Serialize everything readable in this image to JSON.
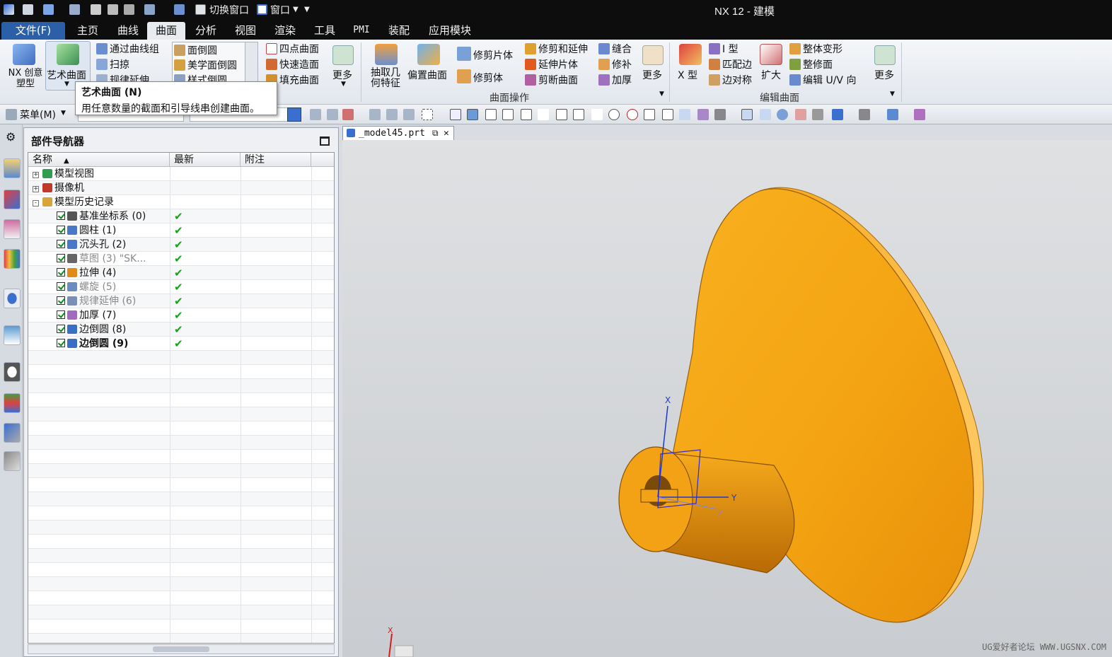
{
  "titlebar": {
    "switch_window": "切换窗口",
    "window": "窗口",
    "title": "NX 12 - 建模"
  },
  "tabs": [
    "文件(F)",
    "主页",
    "曲线",
    "曲面",
    "分析",
    "视图",
    "渲染",
    "工具",
    "PMI",
    "装配",
    "应用模块"
  ],
  "ribbon": {
    "nx_creative": "NX 创意塑型",
    "art_surface": "艺术曲面",
    "through_curve_mesh": "通过曲线组",
    "sweep": "扫掠",
    "law_extension": "规律延伸",
    "face_blend": "面倒圆",
    "aesthetic_blend": "美学面倒圆",
    "style_blend": "样式倒圆",
    "four_point": "四点曲面",
    "rapid_surface": "快速造面",
    "fill_surface": "填充曲面",
    "more1": "更多",
    "extract_geometry": "抽取几何特征",
    "offset_surface": "偏置曲面",
    "trim_sheet": "修剪片体",
    "trim_body": "修剪体",
    "trim_extend": "修剪和延伸",
    "extend_sheet": "延伸片体",
    "divide_face": "剪断曲面",
    "sew": "缝合",
    "patch": "修补",
    "thicken": "加厚",
    "more2": "更多",
    "group_surface_ops": "曲面操作",
    "x_form": "X 型",
    "i_form": "I 型",
    "match_edge": "匹配边",
    "symmetric": "边对称",
    "enlarge": "扩大",
    "global_shaping": "整体变形",
    "global_face": "整修面",
    "edit_uv": "编辑 U/V 向",
    "more3": "更多",
    "group_edit_surface": "编辑曲面"
  },
  "tooltip": {
    "title": "艺术曲面 (N)",
    "text": "用任意数量的截面和引导线串创建曲面。"
  },
  "toolbar2": {
    "menu": "菜单(M)"
  },
  "navigator": {
    "title": "部件导航器",
    "columns": [
      "名称",
      "最新",
      "附注"
    ],
    "rows": [
      {
        "name": "模型视图",
        "latest": "",
        "level": 0,
        "expander": "+",
        "icon_color": "#2f9e52"
      },
      {
        "name": "摄像机",
        "latest": "",
        "level": 0,
        "expander": "+",
        "icon_color": "#c0392b"
      },
      {
        "name": "模型历史记录",
        "latest": "",
        "level": 0,
        "expander": "-",
        "icon_color": "#d9a53a"
      },
      {
        "name": "基准坐标系 (0)",
        "latest": "✔",
        "level": 1,
        "icon_color": "#555555",
        "dim": false
      },
      {
        "name": "圆柱 (1)",
        "latest": "✔",
        "level": 1,
        "icon_color": "#4a78c8",
        "dim": false
      },
      {
        "name": "沉头孔 (2)",
        "latest": "✔",
        "level": 1,
        "icon_color": "#4a78c8",
        "dim": false
      },
      {
        "name": "草图 (3) \"SK...",
        "latest": "✔",
        "level": 1,
        "icon_color": "#666666",
        "dim": true
      },
      {
        "name": "拉伸 (4)",
        "latest": "✔",
        "level": 1,
        "icon_color": "#e08a1a",
        "dim": false
      },
      {
        "name": "螺旋 (5)",
        "latest": "✔",
        "level": 1,
        "icon_color": "#6a8cc0",
        "dim": true
      },
      {
        "name": "规律延伸 (6)",
        "latest": "✔",
        "level": 1,
        "icon_color": "#7a8fb8",
        "dim": true
      },
      {
        "name": "加厚 (7)",
        "latest": "✔",
        "level": 1,
        "icon_color": "#a06cc0",
        "dim": false
      },
      {
        "name": "边倒圆 (8)",
        "latest": "✔",
        "level": 1,
        "icon_color": "#3a6fc4",
        "dim": false
      },
      {
        "name": "边倒圆 (9)",
        "latest": "✔",
        "level": 1,
        "icon_color": "#3a6fc4",
        "dim": false,
        "bold": true
      }
    ]
  },
  "viewport": {
    "tab_label": "_model45.prt",
    "axis_x": "X",
    "axis_y": "Y",
    "axis_z": "Z",
    "corner_x": "X",
    "watermark": "UG爱好者论坛 WWW.UGSNX.COM",
    "part_color": "#f0a010"
  }
}
